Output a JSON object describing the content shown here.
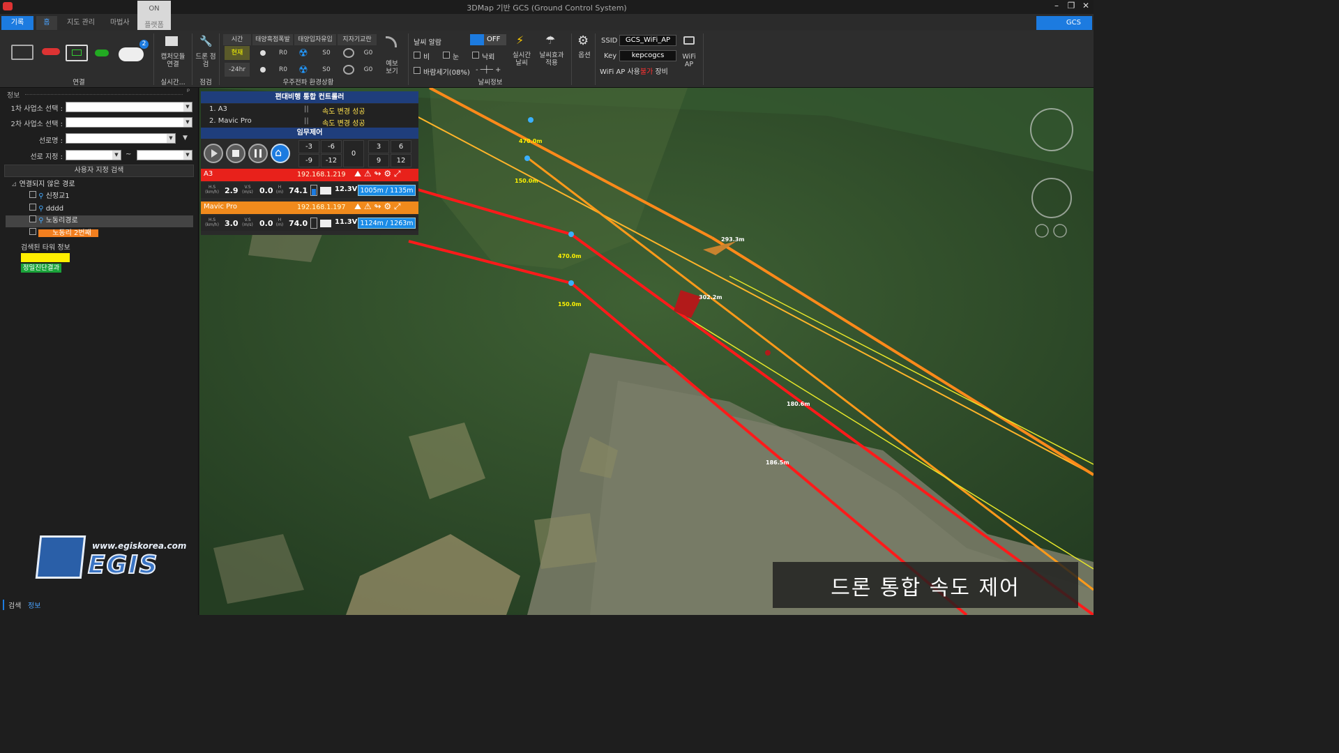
{
  "window": {
    "title": "3DMap 기반 GCS (Ground Control System)"
  },
  "menu": {
    "tabs": [
      "기록",
      "홈",
      "지도 관리",
      "마법사"
    ],
    "toggle_state": "ON",
    "plugin_label": "플랫폼",
    "right_tab": "GCS"
  },
  "ribbon": {
    "connect_group": "연결",
    "capture_label": "캡처모듈 연결",
    "realtime_group": "실시간...",
    "drone_check": "드론 점검",
    "check_group": "점검",
    "space_headers": [
      "시간",
      "태양흑점폭발",
      "태양입자유입",
      "지자기교란"
    ],
    "space_rows": [
      {
        "time": "현재",
        "r": "R0",
        "s": "S0",
        "g": "G0"
      },
      {
        "time": "-24hr",
        "r": "R0",
        "s": "S0",
        "g": "G0"
      }
    ],
    "space_group": "우주전파 환경상황",
    "forecast_label": "예보 보기",
    "weather_alarm": "날씨 알람",
    "toggle_off": "OFF",
    "weather_checks": [
      "비",
      "눈",
      "낙뢰"
    ],
    "wind_label": "바람세기(08%)",
    "realtime_weather": "실시간 날씨",
    "weather_effect": "날씨효과 적용",
    "weather_group": "날씨정보",
    "options_label": "옵션",
    "ssid_label": "SSID",
    "ssid_value": "GCS_WiFi_AP",
    "key_label": "Key",
    "key_value": "kepcogcs",
    "wifi_status_pre": "WiFi AP 사용",
    "wifi_status_mid": "불가",
    "wifi_status_post": " 장비",
    "wifi_ap": "WiFi AP"
  },
  "left": {
    "panel_title": "정보",
    "pin": "ᵖ",
    "site1_label": "1차 사업소 선택 :",
    "site2_label": "2차 사업소 선택 :",
    "line_label": "선로명 :",
    "route_label": "선로 지정 :",
    "tilde": "~",
    "search_button": "사용자 지정 검색",
    "tree_root": "연결되지 않은 경로",
    "tree_items": [
      "신정교1",
      "dddd",
      "노동리경로",
      "노동리 2번째"
    ],
    "found_title": "검색된 타워 정보",
    "tag_yellow": "",
    "tag_green": "정밀진단결과",
    "bottom_tabs": [
      "검색",
      "정보"
    ]
  },
  "controller": {
    "title": "편대비행 통합 컨트롤러",
    "rows": [
      {
        "name": "1.  A3",
        "sep": "||",
        "status": "속도 변경 성공"
      },
      {
        "name": "2.  Mavic Pro",
        "sep": "||",
        "status": "속도 변경 성공"
      }
    ],
    "mission_title": "임무제어",
    "num_top": [
      "-3",
      "-6",
      "3",
      "6"
    ],
    "num_mid": "0",
    "num_bottom": [
      "-9",
      "-12",
      "9",
      "12"
    ],
    "drones": [
      {
        "name": "A3",
        "ip": "192.168.1.219",
        "hs": "2.9",
        "vs": "0.0",
        "h": "74.1",
        "volt": "12.3V",
        "dist": "1005m / 1135m",
        "color": "#e8211b"
      },
      {
        "name": "Mavic Pro",
        "ip": "192.168.1.197",
        "hs": "3.0",
        "vs": "0.0",
        "h": "74.0",
        "volt": "11.3V",
        "dist": "1124m / 1263m",
        "color": "#f08a1c"
      }
    ],
    "units": {
      "hs": "H.S (km/h)",
      "vs": "V.S (m/s)",
      "h": "H (m)"
    }
  },
  "map": {
    "labels": [
      "470.0m",
      "150.0m",
      "470.0m",
      "150.0m",
      "293.3m",
      "302.2m",
      "180.6m",
      "186.5m"
    ]
  },
  "logo": {
    "url_text": "www.egiskorea.com",
    "name": "EGIS"
  },
  "caption": "드론 통합 속도 제어"
}
